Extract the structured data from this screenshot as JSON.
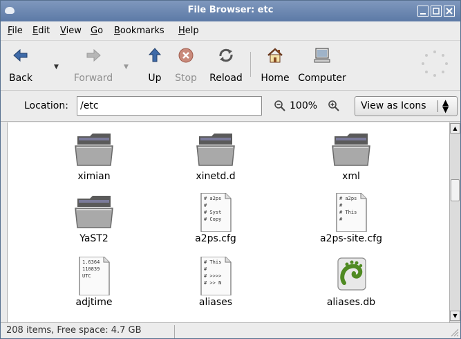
{
  "window": {
    "title": "File Browser: etc"
  },
  "menu": [
    "File",
    "Edit",
    "View",
    "Go",
    "Bookmarks",
    "Help"
  ],
  "toolbar": {
    "back": "Back",
    "forward": "Forward",
    "up": "Up",
    "stop": "Stop",
    "reload": "Reload",
    "home": "Home",
    "computer": "Computer"
  },
  "location": {
    "label": "Location:",
    "value": "/etc",
    "zoom": "100%",
    "view_mode": "View as Icons"
  },
  "files": [
    {
      "name": "ximian",
      "icon": "folder-icon"
    },
    {
      "name": "xinetd.d",
      "icon": "folder-icon"
    },
    {
      "name": "xml",
      "icon": "folder-icon"
    },
    {
      "name": "YaST2",
      "icon": "folder-icon"
    },
    {
      "name": "a2ps.cfg",
      "icon": "text-file-icon",
      "preview": [
        "# a2ps",
        "#",
        "# Syst",
        "# Copy"
      ]
    },
    {
      "name": "a2ps-site.cfg",
      "icon": "text-file-icon",
      "preview": [
        "# a2ps",
        "#",
        "# This",
        "#"
      ]
    },
    {
      "name": "adjtime",
      "icon": "text-file-icon",
      "preview": [
        "1.6364",
        "110839",
        "UTC"
      ]
    },
    {
      "name": "aliases",
      "icon": "text-file-icon",
      "preview": [
        "# This",
        "#",
        "# >>>>",
        "# >> N"
      ]
    },
    {
      "name": "aliases.db",
      "icon": "gnome-database-icon"
    }
  ],
  "status": {
    "text": "208 items, Free space: 4.7 GB"
  },
  "colors": {
    "titlebar": "#6a86b0",
    "folder": "#8a8a8a",
    "stop": "#c0503a",
    "gnome_foot": "#4f8a22"
  }
}
